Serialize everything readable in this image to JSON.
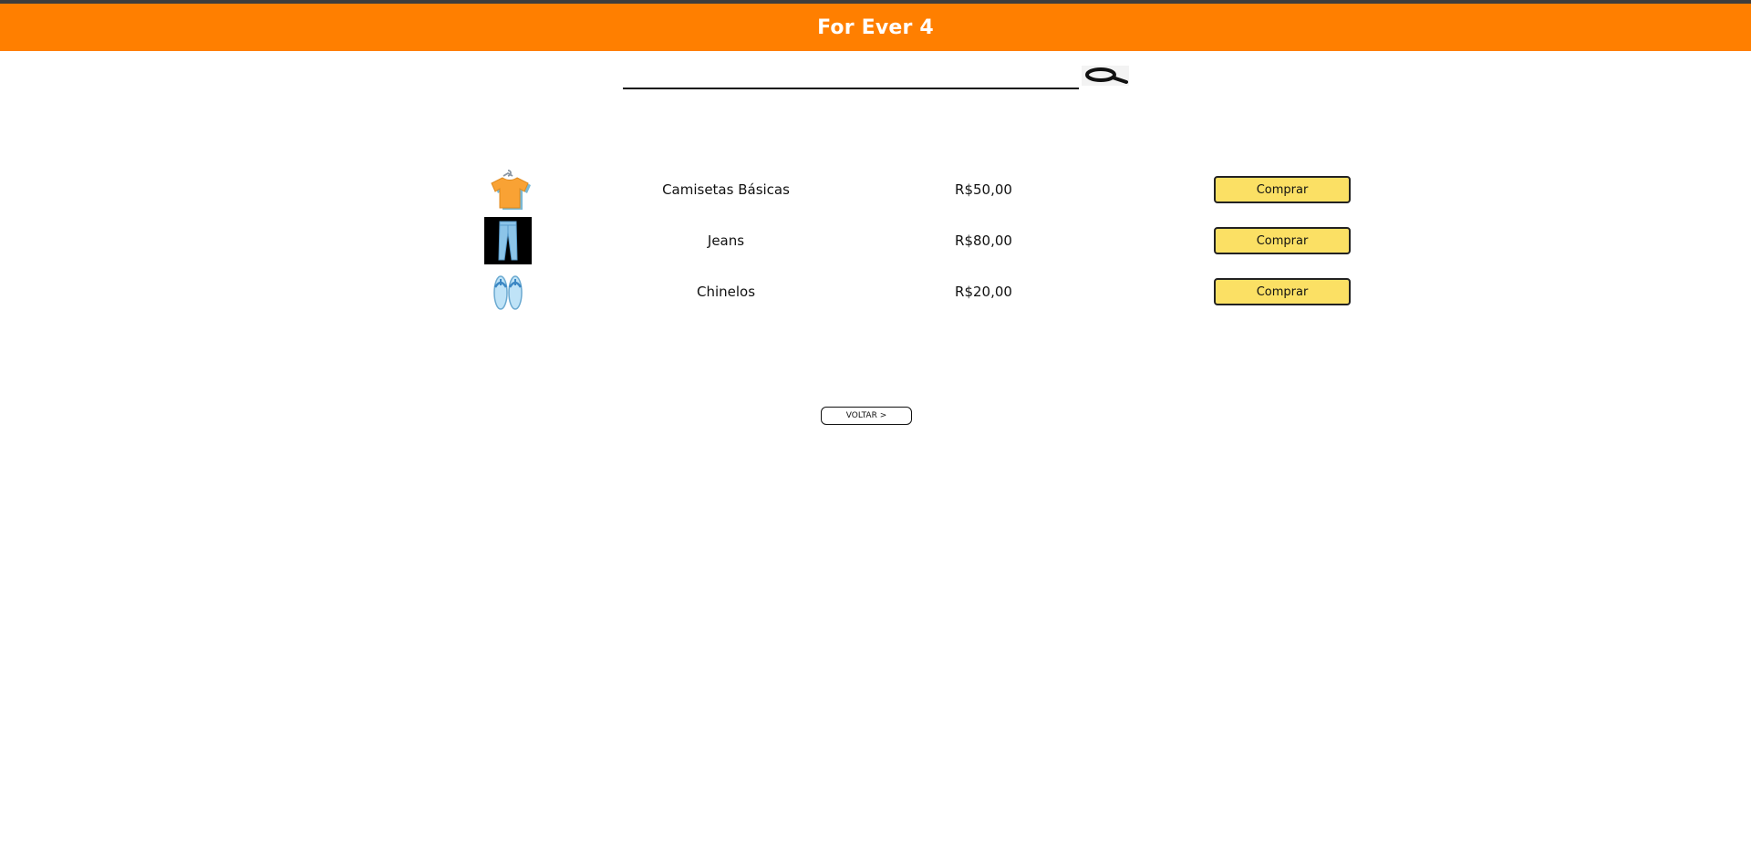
{
  "header": {
    "title": "For Ever 4"
  },
  "search": {
    "value": "",
    "placeholder": "",
    "button_icon": "search-icon"
  },
  "products": [
    {
      "icon": "tshirt-icon",
      "name": "Camisetas Básicas",
      "price": "R$50,00",
      "button_label": "Comprar"
    },
    {
      "icon": "jeans-icon",
      "name": "Jeans",
      "price": "R$80,00",
      "button_label": "Comprar"
    },
    {
      "icon": "flip-flops-icon",
      "name": "Chinelos",
      "price": "R$20,00",
      "button_label": "Comprar"
    }
  ],
  "footer": {
    "back_label": "VOLTAR >"
  },
  "colors": {
    "header_bg": "#ff7f00",
    "buy_button_bg": "#fbe064",
    "header_text": "#ffffff"
  }
}
